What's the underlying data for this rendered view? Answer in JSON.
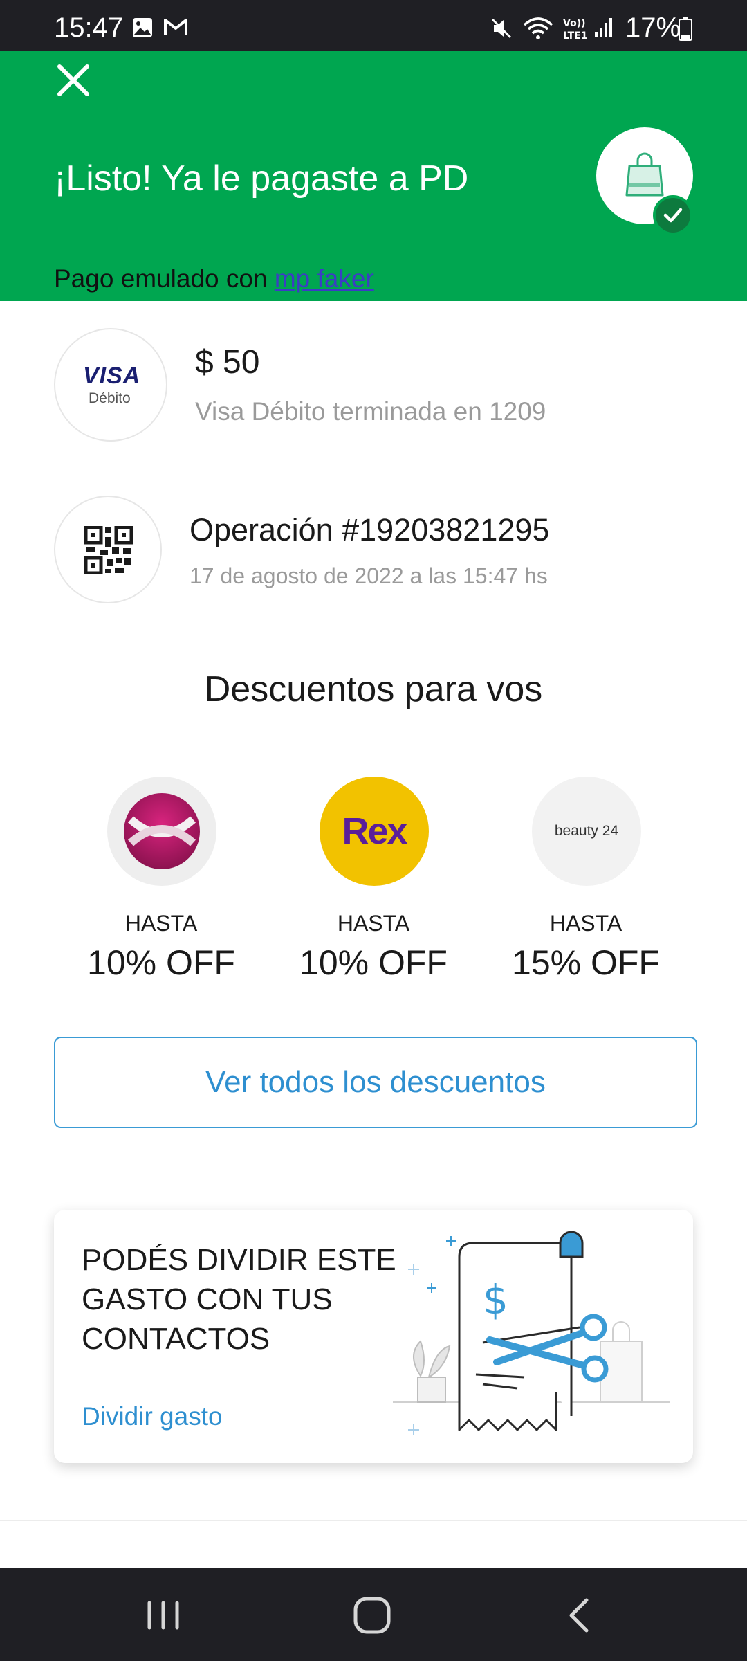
{
  "status_bar": {
    "time": "15:47",
    "battery_percent": "17%",
    "icons": [
      "gallery-icon",
      "gmail-icon",
      "mute-icon",
      "wifi-icon",
      "volte-icon",
      "signal-icon",
      "battery-icon"
    ]
  },
  "header": {
    "title": "¡Listo! Ya le pagaste a PD",
    "subtitle_prefix": "Pago emulado con ",
    "subtitle_link": "mp faker",
    "background_color": "#00a650",
    "icons": [
      "close-icon",
      "shopping-bag-icon",
      "check-icon"
    ]
  },
  "payment": {
    "card_brand": "VISA",
    "card_type": "Débito",
    "amount": "$ 50",
    "card_description": "Visa Débito terminada en 1209"
  },
  "operation": {
    "title": "Operación #19203821295",
    "date": "17 de agosto de 2022 a las 15:47 hs",
    "icon": "qr-code-icon"
  },
  "discounts": {
    "title": "Descuentos para vos",
    "items": [
      {
        "brand": "Xtreme",
        "label": "HASTA",
        "value": "10% OFF",
        "logo_color": "#b0175f"
      },
      {
        "brand": "Rex",
        "logo_text": "Rex",
        "label": "HASTA",
        "value": "10% OFF",
        "logo_color": "#f2c200"
      },
      {
        "brand": "beauty 24",
        "logo_text": "beauty 24",
        "label": "HASTA",
        "value": "15% OFF",
        "logo_color": "#f2f2f2"
      }
    ],
    "see_all_label": "Ver todos los descuentos"
  },
  "split": {
    "title": "PODÉS DIVIDIR ESTE GASTO CON TUS CONTACTOS",
    "link_label": "Dividir gasto",
    "illustration": "receipt-scissors-illustration"
  },
  "nav_bar": {
    "buttons": [
      "recent-apps",
      "home",
      "back"
    ]
  },
  "colors": {
    "accent_blue": "#2e8fd0",
    "success_green": "#00a650",
    "dark_green": "#0d7a3e"
  }
}
